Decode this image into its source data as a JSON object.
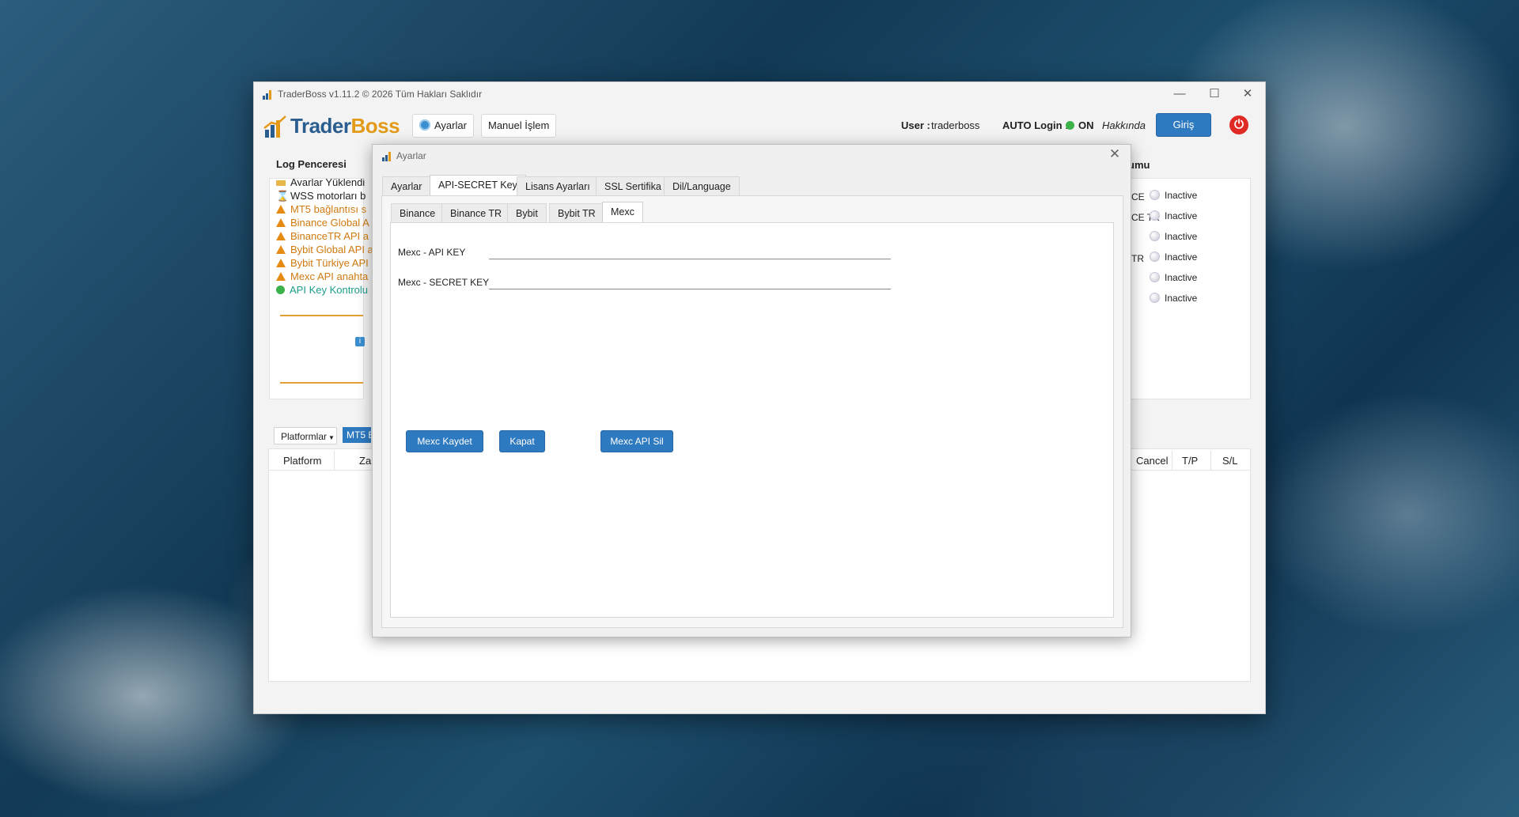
{
  "window": {
    "title": "TraderBoss  v1.11.2  © 2026  Tüm Hakları Saklıdır",
    "logo_text_a": "Trader",
    "logo_text_b": "Boss"
  },
  "toolbar": {
    "settings_label": "Ayarlar",
    "manual_label": "Manuel İşlem",
    "user_label": "User :",
    "user_value": "traderboss",
    "auto_login_label": "AUTO Login :",
    "auto_login_value": "ON",
    "about_label": "Hakkında",
    "login_button": "Giriş"
  },
  "log": {
    "title": "Log Penceresi",
    "lines": [
      {
        "icon": "folder-icon",
        "text": "Ayarlar Yüklendi",
        "color": "#222222"
      },
      {
        "icon": "hourglass-icon",
        "text": "WSS motorları b",
        "color": "#222222"
      },
      {
        "icon": "warning-icon",
        "text": "MT5 bağlantısı s",
        "color": "#d07a10"
      },
      {
        "icon": "warning-icon",
        "text": "Binance Global A",
        "color": "#d07a10"
      },
      {
        "icon": "warning-icon",
        "text": "BinanceTR API a",
        "color": "#d07a10"
      },
      {
        "icon": "warning-icon",
        "text": "Bybit Global API a",
        "color": "#d07a10"
      },
      {
        "icon": "warning-icon",
        "text": "Bybit Türkiye API",
        "color": "#d07a10"
      },
      {
        "icon": "warning-icon",
        "text": "Mexc API anahta",
        "color": "#d07a10"
      },
      {
        "icon": "green-dot-icon",
        "text": "API Key Kontrolu",
        "color": "#1b9e8a"
      }
    ]
  },
  "status": {
    "title_fragment": "umu",
    "rows": [
      {
        "name_fragment": "CE",
        "value": "Inactive"
      },
      {
        "name_fragment": "CE TR",
        "value": "Inactive"
      },
      {
        "name_fragment": "",
        "value": "Inactive"
      },
      {
        "name_fragment": "TR",
        "value": "Inactive"
      },
      {
        "name_fragment": "",
        "value": "Inactive"
      },
      {
        "name_fragment": "",
        "value": "Inactive"
      }
    ]
  },
  "bottom": {
    "platforms_dropdown": "Platformlar",
    "mt5_badge": "MT5 E",
    "columns_left": [
      "Platform",
      "Za"
    ],
    "columns_right": [
      "Cancel",
      "T/P",
      "S/L"
    ]
  },
  "dialog": {
    "title": "Ayarlar",
    "tabs": [
      "Ayarlar",
      "API-SECRET Key",
      "Lisans Ayarları",
      "SSL Sertifika",
      "Dil/Language"
    ],
    "selected_tab": "API-SECRET Key",
    "subtabs": [
      "Binance",
      "Binance TR",
      "Bybit",
      "Bybit TR",
      "Mexc"
    ],
    "selected_subtab": "Mexc",
    "api_key_label": "Mexc - API KEY",
    "api_key_value": "",
    "secret_key_label": "Mexc - SECRET KEY",
    "secret_key_value": "",
    "save_button": "Mexc  Kaydet",
    "close_button": "Kapat",
    "delete_button": "Mexc API Sil"
  },
  "colors": {
    "accent_blue": "#2e7ac0",
    "brand_orange": "#e39a18",
    "brand_blue": "#2a5d8f",
    "power_red": "#e02a24",
    "on_green": "#3bb24a"
  }
}
